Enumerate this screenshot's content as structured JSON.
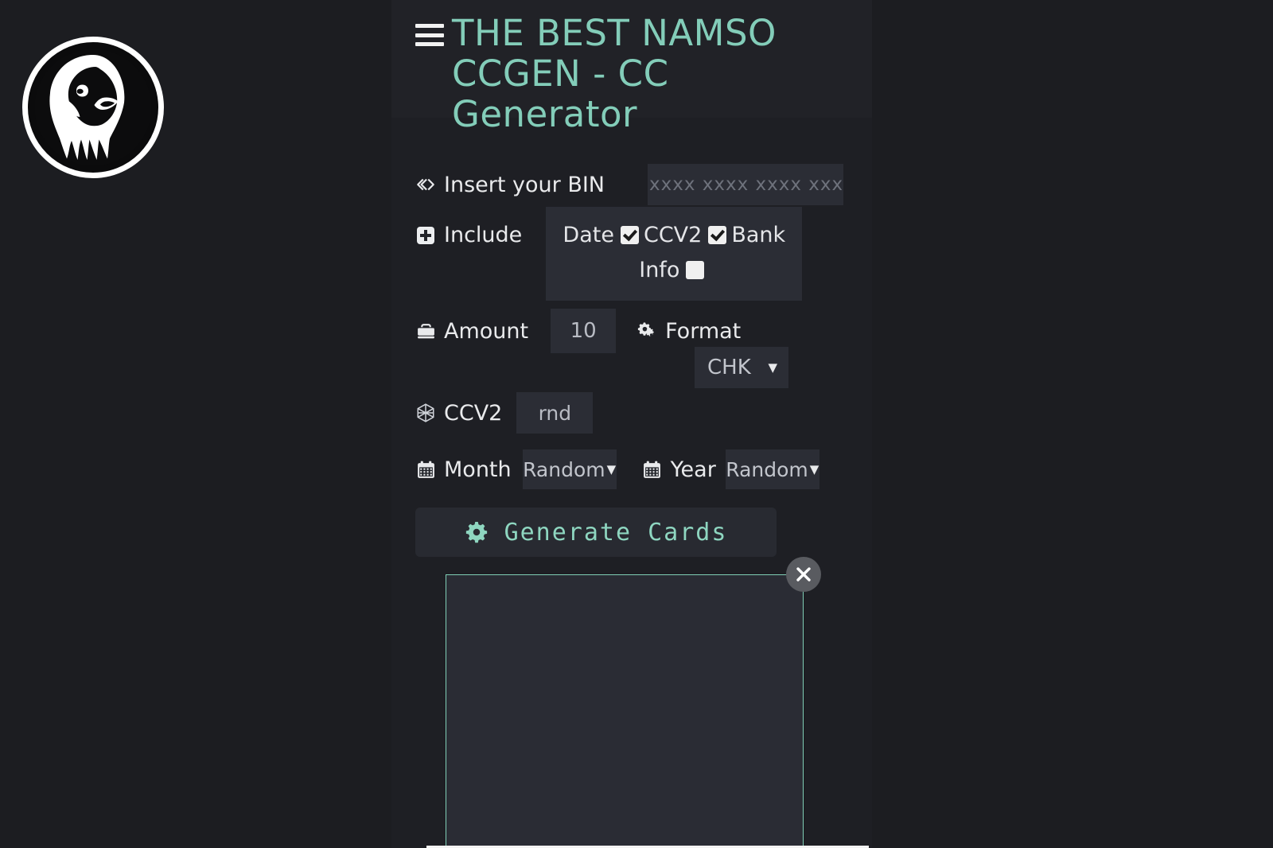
{
  "app": {
    "title": "THE BEST NAMSO CCGEN - CC Generator",
    "menu_icon": "hamburger-menu-icon",
    "logo_alt": "lion-head-logo",
    "accent_color": "#83cdb9",
    "background_color": "#1c1d21",
    "panel_color": "#202126",
    "field_color": "#2b2d35"
  },
  "form": {
    "bin": {
      "icon": "code-icon",
      "label": "Insert your BIN",
      "placeholder": "xxxx xxxx xxxx xxxx",
      "value": ""
    },
    "include": {
      "icon": "plus-square-icon",
      "label": "Include",
      "options": [
        {
          "label": "Date",
          "checked": true
        },
        {
          "label": "CCV2",
          "checked": true
        },
        {
          "label": "Bank Info",
          "checked": false
        }
      ]
    },
    "amount": {
      "icon": "briefcase-icon",
      "label": "Amount",
      "value": "10"
    },
    "format": {
      "icon": "cogs-icon",
      "label": "Format",
      "value": "CHK",
      "caret": "▼"
    },
    "ccv2": {
      "icon": "hexagon-icon",
      "label": "CCV2",
      "value": "rnd"
    },
    "month": {
      "icon": "calendar-icon",
      "label": "Month",
      "value": "Random",
      "caret": "▼"
    },
    "year": {
      "icon": "calendar-icon",
      "label": "Year",
      "value": "Random",
      "caret": "▼"
    },
    "generate_button": {
      "icon": "gear-icon",
      "label": "Generate Cards"
    }
  },
  "output": {
    "value": "",
    "placeholder": "",
    "close_icon": "close-x-icon",
    "border_color": "#7fcfb6"
  }
}
